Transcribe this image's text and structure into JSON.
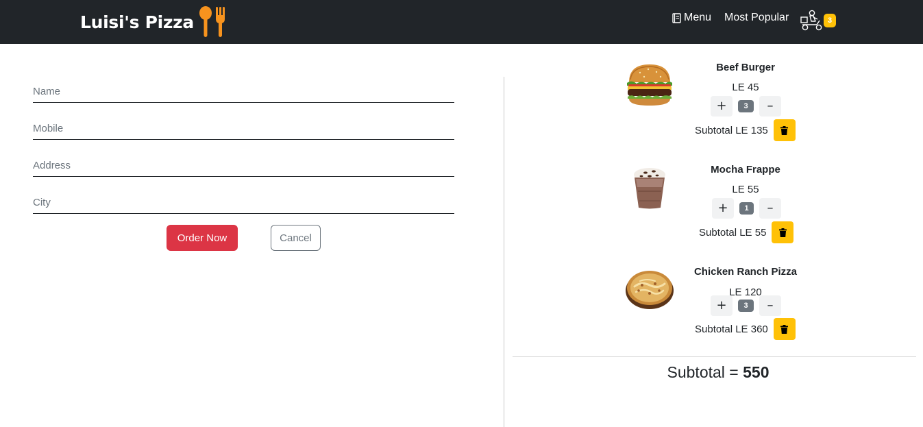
{
  "navbar": {
    "brand": "Luisi's Pizza",
    "menu_label": "Menu",
    "popular_label": "Most Popular",
    "cart_count": "3",
    "colors": {
      "background": "#212529",
      "logo": "#f7931e",
      "badge": "#ffc107"
    },
    "icons": [
      "spoon-fork-logo-icon",
      "book-icon",
      "delivery-scooter-icon"
    ]
  },
  "form": {
    "name_placeholder": "Name",
    "mobile_placeholder": "Mobile",
    "address_placeholder": "Address",
    "city_placeholder": "City",
    "order_label": "Order Now",
    "cancel_label": "Cancel",
    "colors": {
      "order": "#dc3545",
      "cancel": "#6c757d"
    }
  },
  "cart": {
    "items": [
      {
        "name": "Beef Burger",
        "price": "LE 45",
        "qty": "3",
        "plus": "+",
        "minus": "–",
        "subtotal": "Subtotal LE 135",
        "image": "burger-image"
      },
      {
        "name": "Mocha Frappe",
        "price": "LE 55",
        "qty": "1",
        "plus": "+",
        "minus": "–",
        "subtotal": "Subtotal LE 55",
        "image": "frappe-image"
      },
      {
        "name": "Chicken Ranch Pizza",
        "price": "LE 120",
        "qty": "3",
        "plus": "+",
        "minus": "–",
        "subtotal": "Subtotal LE 360",
        "image": "pizza-image"
      }
    ],
    "total_label": "Subtotal = ",
    "total_value": "550",
    "colors": {
      "delete": "#ffc107",
      "qty_badge": "#6c757d"
    }
  }
}
